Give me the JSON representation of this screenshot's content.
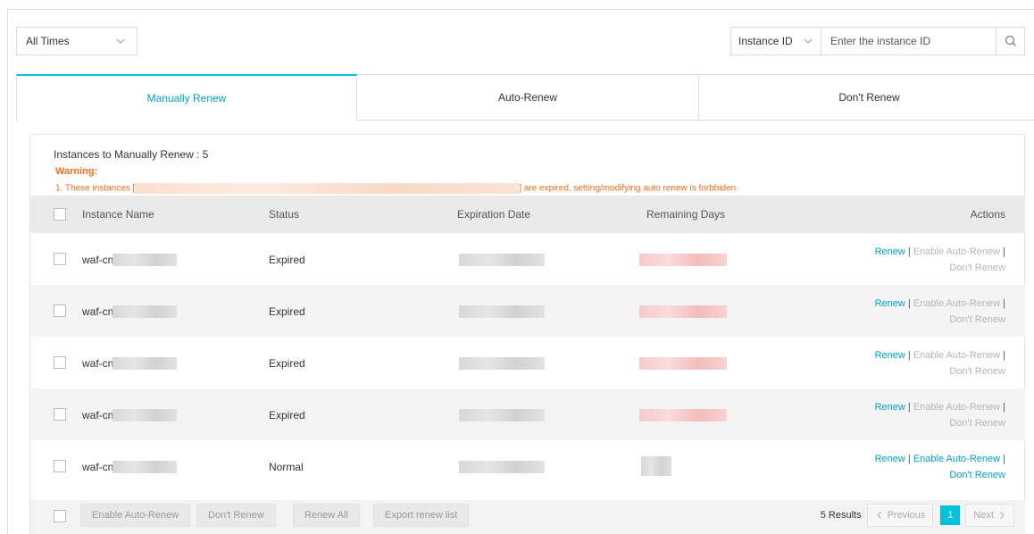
{
  "filter": {
    "time_selected": "All Times"
  },
  "search": {
    "field_selected": "Instance ID",
    "placeholder": "Enter the instance ID"
  },
  "tabs": [
    {
      "label": "Manually Renew",
      "active": true
    },
    {
      "label": "Auto-Renew",
      "active": false
    },
    {
      "label": "Don't Renew",
      "active": false
    }
  ],
  "summary": {
    "label": "Instances to Manually Renew",
    "separator": " : ",
    "count": "5"
  },
  "warning": {
    "title": "Warning:",
    "prefix": "1. These instances [",
    "suffix": "] are expired, setting/modifying auto renew is forbbiden."
  },
  "table": {
    "columns": {
      "name": "Instance Name",
      "status": "Status",
      "expiration": "Expiration Date",
      "remaining": "Remaining Days",
      "actions": "Actions"
    },
    "rows": [
      {
        "name": "waf-cn",
        "status": "Expired",
        "actions_enabled": false
      },
      {
        "name": "waf-cn",
        "status": "Expired",
        "actions_enabled": false
      },
      {
        "name": "waf-cn",
        "status": "Expired",
        "actions_enabled": false
      },
      {
        "name": "waf-cn",
        "status": "Expired",
        "actions_enabled": false
      },
      {
        "name": "waf-cn",
        "status": "Normal",
        "actions_enabled": true
      }
    ],
    "row_actions": {
      "renew": "Renew",
      "enable_auto": "Enable Auto-Renew",
      "dont_renew": "Don't Renew",
      "separator": "|"
    }
  },
  "footer": {
    "buttons": {
      "enable_auto": "Enable Auto-Renew",
      "dont_renew": "Don't Renew",
      "renew_all": "Renew All",
      "export": "Export renew list"
    },
    "results": "5 Results",
    "prev": "Previous",
    "page": "1",
    "next": "Next"
  },
  "colors": {
    "accent": "#00c1de",
    "link": "#00a2ca",
    "warning": "#f36b1d"
  },
  "icons": {
    "chevron": "chevron-down-icon",
    "search": "search-icon",
    "prev": "chevron-left-icon",
    "next": "chevron-right-icon"
  }
}
